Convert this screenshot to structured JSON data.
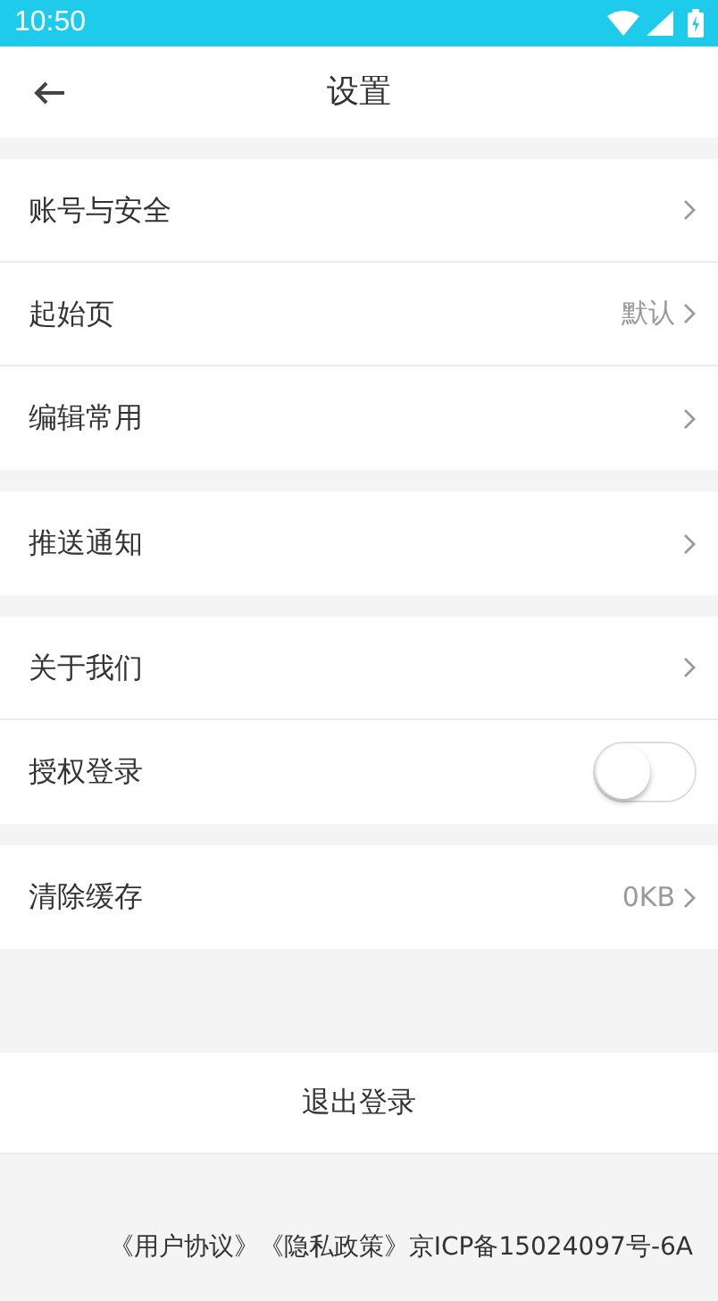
{
  "status_bar": {
    "time": "10:50"
  },
  "header": {
    "title": "设置"
  },
  "groups": [
    {
      "rows": [
        {
          "kind": "link",
          "label": "账号与安全"
        },
        {
          "kind": "link",
          "label": "起始页",
          "value": "默认"
        },
        {
          "kind": "link",
          "label": "编辑常用"
        }
      ]
    },
    {
      "rows": [
        {
          "kind": "link",
          "label": "推送通知"
        }
      ]
    },
    {
      "rows": [
        {
          "kind": "link",
          "label": "关于我们"
        },
        {
          "kind": "toggle",
          "label": "授权登录",
          "on": false
        }
      ]
    },
    {
      "rows": [
        {
          "kind": "link",
          "label": "清除缓存",
          "value": "0KB"
        }
      ]
    }
  ],
  "logout_button": "退出登录",
  "footer": {
    "links": [
      "《用户协议》",
      "《隐私政策》"
    ],
    "icp": "京ICP备15024097号-6A"
  }
}
